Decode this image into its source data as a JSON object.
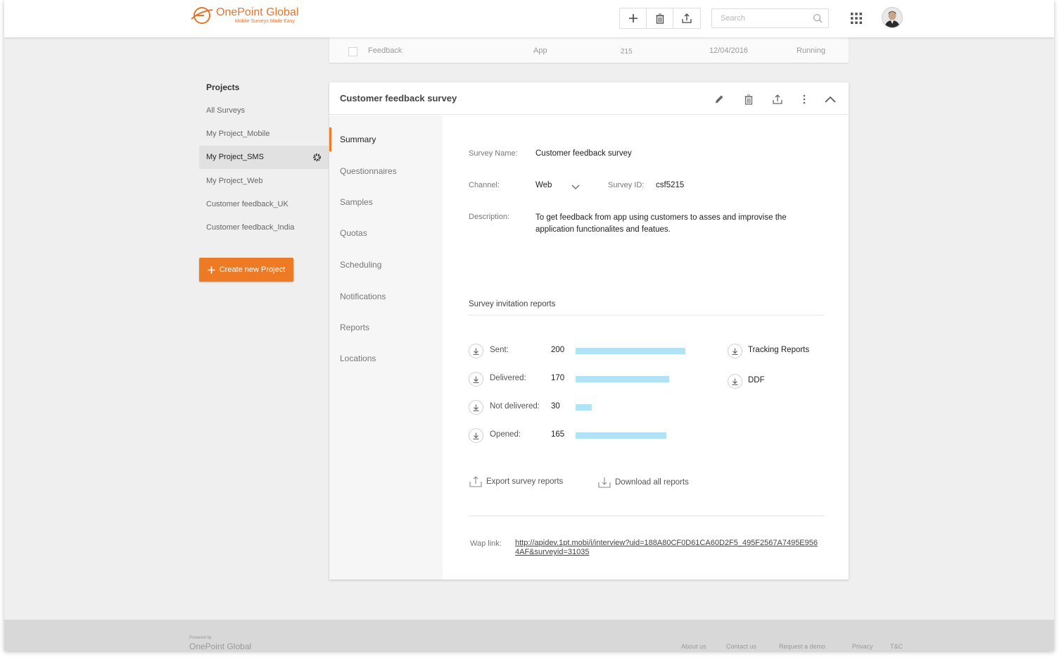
{
  "app": {
    "brand_name": "OnePoint Global",
    "tagline": "Mobile Surveys Made Easy",
    "accent_color": "#ef7a24"
  },
  "toolbar": {
    "add_icon": "plus-icon",
    "delete_icon": "trash-icon",
    "share_icon": "upload-icon"
  },
  "search": {
    "placeholder": "Search"
  },
  "background_row": {
    "name": "Feedback",
    "channel": "App",
    "count": "215",
    "date": "12/04/2016",
    "status": "Running"
  },
  "projects": {
    "title": "Projects",
    "items": [
      {
        "label": "All Surveys"
      },
      {
        "label": "My Project_Mobile"
      },
      {
        "label": "My Project_SMS",
        "active": true
      },
      {
        "label": "My Project_Web"
      },
      {
        "label": "Customer feedback_UK"
      },
      {
        "label": "Customer feedback_India"
      }
    ],
    "create_label": "Create new Project"
  },
  "card": {
    "title": "Customer feedback survey",
    "nav": [
      {
        "label": "Summary",
        "active": true
      },
      {
        "label": "Questionnaires"
      },
      {
        "label": "Samples"
      },
      {
        "label": "Quotas"
      },
      {
        "label": "Scheduling"
      },
      {
        "label": "Notifications"
      },
      {
        "label": "Reports"
      },
      {
        "label": "Locations"
      }
    ],
    "summary": {
      "survey_name_label": "Survey Name:",
      "survey_name": "Customer feedback survey",
      "channel_label": "Channel:",
      "channel": "Web",
      "survey_id_label": "Survey ID:",
      "survey_id": "csf5215",
      "description_label": "Description:",
      "description": "To get feedback from app using customers to asses and improvise the application functionalites and featues."
    },
    "reports": {
      "title": "Survey invitation reports",
      "bar_color": "#b0e3f6",
      "stats": [
        {
          "label": "Sent:",
          "value": 200
        },
        {
          "label": "Delivered:",
          "value": 170
        },
        {
          "label": "Not delivered:",
          "value": 30
        },
        {
          "label": "Opened:",
          "value": 165
        }
      ],
      "tracking_label": "Tracking Reports",
      "ddf_label": "DDF",
      "export_label": "Export survey reports",
      "download_all_label": "Download all reports"
    },
    "wap": {
      "label": "Wap link:",
      "url": "http://apidev.1pt.mobi/i/interview?uid=188A80CF0D61CA60D2F5_495F2567A7495E9564AF&surveyid=31035"
    }
  },
  "footer": {
    "powered_by": "Powered by",
    "brand": "OnePoint Global",
    "links": [
      "About us",
      "Contact us",
      "Request a demo",
      "Privacy",
      "T&C"
    ]
  }
}
